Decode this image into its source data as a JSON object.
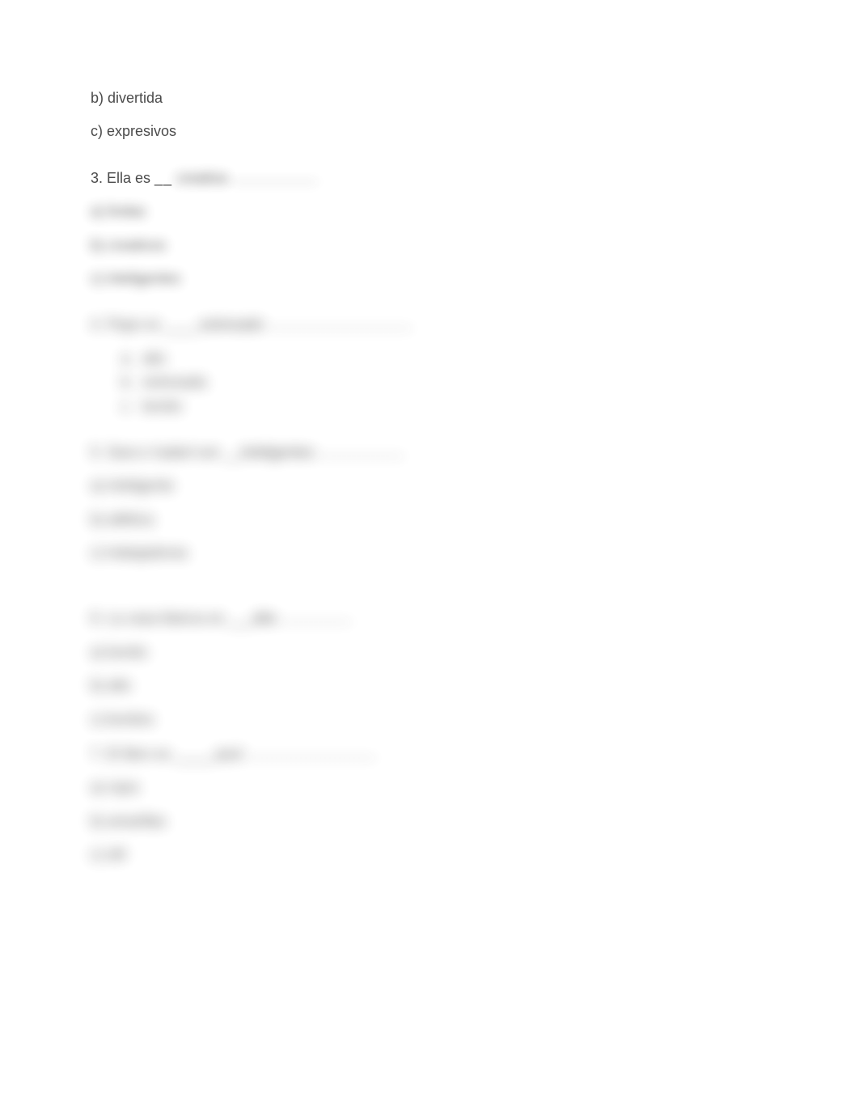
{
  "q2_visible": {
    "choice_b": "b) divertida",
    "choice_c": "c) expresivos"
  },
  "q3": {
    "stem_pre": "3. Ella es ",
    "blank": "__",
    "answer": "  creativa",
    "dots": "………………",
    "a": "a) lindas",
    "b": "b) creativos",
    "c": "c) inteligentes"
  },
  "q4": {
    "stem_pre": "4. Pepe es ",
    "blank": "____",
    "answer": "estresado",
    "dots": "…………………………",
    "sub_a_marker": "a.",
    "sub_a": "alto",
    "sub_b_marker": "b.",
    "sub_b": "estresada",
    "sub_c_marker": "c.",
    "sub_c": "bonito"
  },
  "q5": {
    "stem_pre": "5. Sara e Isabel son __",
    "answer": "inteligentes",
    "dots": "………………",
    "a": "a) inteligente",
    "b": "b) atlética",
    "c": "c) trabajadoras"
  },
  "q6": {
    "stem_pre": "6. La casa blanca es ___",
    "answer": "alta",
    "dots": "……………",
    "a": "a) bonito",
    "b": "b) alto",
    "c": "c) bonitos"
  },
  "q7": {
    "stem_pre": "7. El libro es _____",
    "answer": "azul",
    "dots": "………………………",
    "a": "a) rojos",
    "b": "b) amarillas",
    "c": "c) útil"
  }
}
